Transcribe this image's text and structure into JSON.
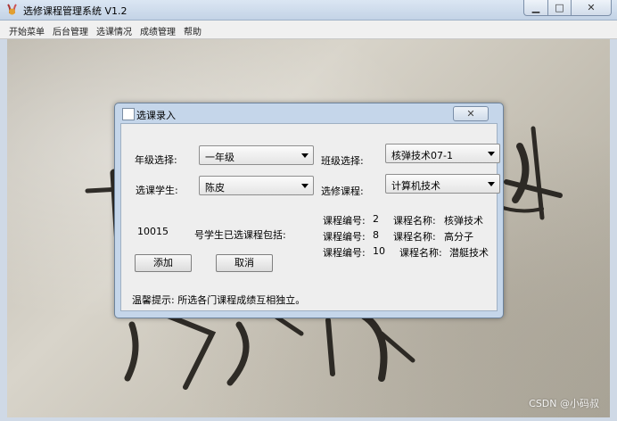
{
  "window": {
    "title": "选修课程管理系统 V1.2",
    "minimize_icon": "minimize-icon",
    "maximize_icon": "maximize-icon",
    "close_icon": "close-icon",
    "minimize_glyph": "▁",
    "maximize_glyph": "□",
    "close_glyph": "✕"
  },
  "menu": [
    "开始菜单",
    "后台管理",
    "选课情况",
    "成绩管理",
    "帮助"
  ],
  "dialog": {
    "title": "选课录入",
    "close_glyph": "✕",
    "grade_label": "年级选择:",
    "grade_value": "一年级",
    "class_label": "班级选择:",
    "class_value": "核弹技术07-1",
    "student_label": "选课学生:",
    "student_value": "陈皮",
    "course_label": "选修课程:",
    "course_value": "计算机技术",
    "student_id": "10015",
    "selected_text": "号学生已选课程包括:",
    "courses": [
      {
        "no_label": "课程编号:",
        "no": "2",
        "name_label": "课程名称:",
        "name": "核弹技术"
      },
      {
        "no_label": "课程编号:",
        "no": "8",
        "name_label": "课程名称:",
        "name": "高分子"
      },
      {
        "no_label": "课程编号:",
        "no": "10",
        "name_label": "课程名称:",
        "name": "潜艇技术"
      }
    ],
    "add_button": "添加",
    "cancel_button": "取消",
    "tip": "温馨提示: 所选各门课程成绩互相独立。"
  },
  "watermark": "CSDN @小码叔",
  "colors": {
    "titlebar": "#c3d3e6",
    "dialog_frame": "#c5d6ea",
    "dialog_body": "#eeeeee"
  }
}
